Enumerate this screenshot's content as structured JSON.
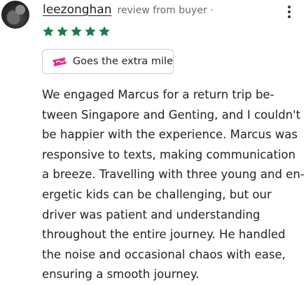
{
  "reviewer": {
    "username": "leezonghan",
    "meta": "review from buyer ·"
  },
  "rating": {
    "stars": 5,
    "max": 5,
    "star_color": "#1c7c4a"
  },
  "badge": {
    "label": "Goes the extra mile",
    "icon": "ticket-icon",
    "icon_color": "#e0338f"
  },
  "review": {
    "lines": [
      "We engaged Marcus for a return trip be-",
      "tween Singapore and Genting, and I couldn't",
      "be happier with the experience. Marcus was",
      "responsive to texts, making communication",
      "a breeze. Travelling with three young and en-",
      "ergetic kids can be challenging, but our",
      "driver was patient and understanding",
      "throughout the entire journey. He handled",
      "the noise and occasional chaos with ease,",
      "ensuring a smooth journey."
    ]
  },
  "menu": {
    "icon": "more-vertical-icon"
  }
}
